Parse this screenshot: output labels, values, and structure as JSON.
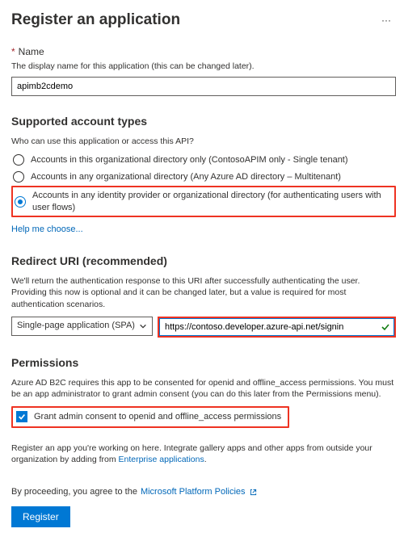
{
  "header": {
    "title": "Register an application",
    "more": "···"
  },
  "name": {
    "label": "Name",
    "hint": "The display name for this application (this can be changed later).",
    "value": "apimb2cdemo"
  },
  "accounts": {
    "heading": "Supported account types",
    "hint": "Who can use this application or access this API?",
    "options": [
      "Accounts in this organizational directory only (ContosoAPIM only - Single tenant)",
      "Accounts in any organizational directory (Any Azure AD directory – Multitenant)",
      "Accounts in any identity provider or organizational directory (for authenticating users with user flows)"
    ],
    "help": "Help me choose..."
  },
  "redirect": {
    "heading": "Redirect URI (recommended)",
    "hint": "We'll return the authentication response to this URI after successfully authenticating the user. Providing this now is optional and it can be changed later, but a value is required for most authentication scenarios.",
    "platform": "Single-page application (SPA)",
    "uri": "https://contoso.developer.azure-api.net/signin"
  },
  "permissions": {
    "heading": "Permissions",
    "hint": "Azure AD B2C requires this app to be consented for openid and offline_access permissions. You must be an app administrator to grant admin consent (you can do this later from the Permissions menu).",
    "checkbox": "Grant admin consent to openid and offline_access permissions"
  },
  "registerNote": {
    "prefix": "Register an app you're working on here. Integrate gallery apps and other apps from outside your organization by adding from ",
    "link": "Enterprise applications",
    "suffix": "."
  },
  "footer": {
    "prefix": "By proceeding, you agree to the ",
    "link": "Microsoft Platform Policies"
  },
  "button": "Register"
}
